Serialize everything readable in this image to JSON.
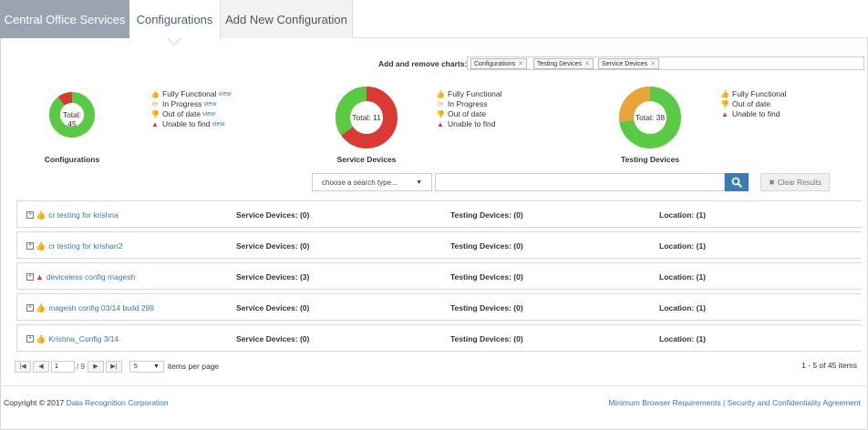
{
  "tabs": [
    {
      "label": "Central Office Services"
    },
    {
      "label": "Configurations"
    },
    {
      "label": "Add New Configuration"
    }
  ],
  "charts_picker": {
    "label": "Add and remove charts:",
    "chips": [
      "Configurations",
      "Testing Devices",
      "Service Devices"
    ]
  },
  "donuts": [
    {
      "title": "Configurations",
      "center": "Total: 45",
      "legend": [
        {
          "label": "Fully Functional",
          "link": "view",
          "icon": "thumbs-up-icon"
        },
        {
          "label": "In Progress",
          "link": "view",
          "icon": "refresh-icon"
        },
        {
          "label": "Out of date",
          "link": "view",
          "icon": "thumbs-down-icon"
        },
        {
          "label": "Unable to find",
          "link": "view",
          "icon": "warning-icon"
        }
      ]
    },
    {
      "title": "Service Devices",
      "center": "Total: 11",
      "legend": [
        {
          "label": "Fully Functional",
          "icon": "thumbs-up-icon"
        },
        {
          "label": "In Progress",
          "icon": "refresh-icon"
        },
        {
          "label": "Out of date",
          "icon": "thumbs-down-icon"
        },
        {
          "label": "Unable to find",
          "icon": "warning-icon"
        }
      ]
    },
    {
      "title": "Testing Devices",
      "center": "Total: 38",
      "legend": [
        {
          "label": "Fully Functional",
          "icon": "thumbs-up-icon"
        },
        {
          "label": "Out of date",
          "icon": "thumbs-down-icon"
        },
        {
          "label": "Unable to find",
          "icon": "warning-icon"
        }
      ]
    }
  ],
  "colors": {
    "green": "#5ac943",
    "red": "#d93a36",
    "orange": "#e9a43c",
    "link": "#3a78b5"
  },
  "search": {
    "type_placeholder": "choose a search type...",
    "query": "",
    "clear_label": "Clear Results"
  },
  "rows": [
    {
      "name": "cr testing for krishna",
      "status": "thumbs-up-icon",
      "service": "Service Devices: (0)",
      "testing": "Testing Devices: (0)",
      "location": "Location: (1)"
    },
    {
      "name": "cr testing for krishan2",
      "status": "thumbs-up-icon",
      "service": "Service Devices: (0)",
      "testing": "Testing Devices: (0)",
      "location": "Location: (1)"
    },
    {
      "name": "deviceless config magesh",
      "status": "warning-icon",
      "service": "Service Devices: (3)",
      "testing": "Testing Devices: (0)",
      "location": "Location: (1)"
    },
    {
      "name": "magesh config 03/14 build 299",
      "status": "thumbs-up-icon",
      "service": "Service Devices: (0)",
      "testing": "Testing Devices: (0)",
      "location": "Location: (1)"
    },
    {
      "name": "Krishna_Config 3/14",
      "status": "thumbs-up-icon",
      "service": "Service Devices: (0)",
      "testing": "Testing Devices: (0)",
      "location": "Location: (1)"
    }
  ],
  "pager": {
    "page": "1",
    "of": "9",
    "page_size": "5",
    "items_per_page": "items per page",
    "summary": "1 - 5 of 45 items"
  },
  "footer": {
    "copyright_prefix": "Copyright © 2017",
    "company": "Data Recognition Corporation",
    "links": "Minimum Browser Requirements | Security and Confidentiality Agreement"
  }
}
